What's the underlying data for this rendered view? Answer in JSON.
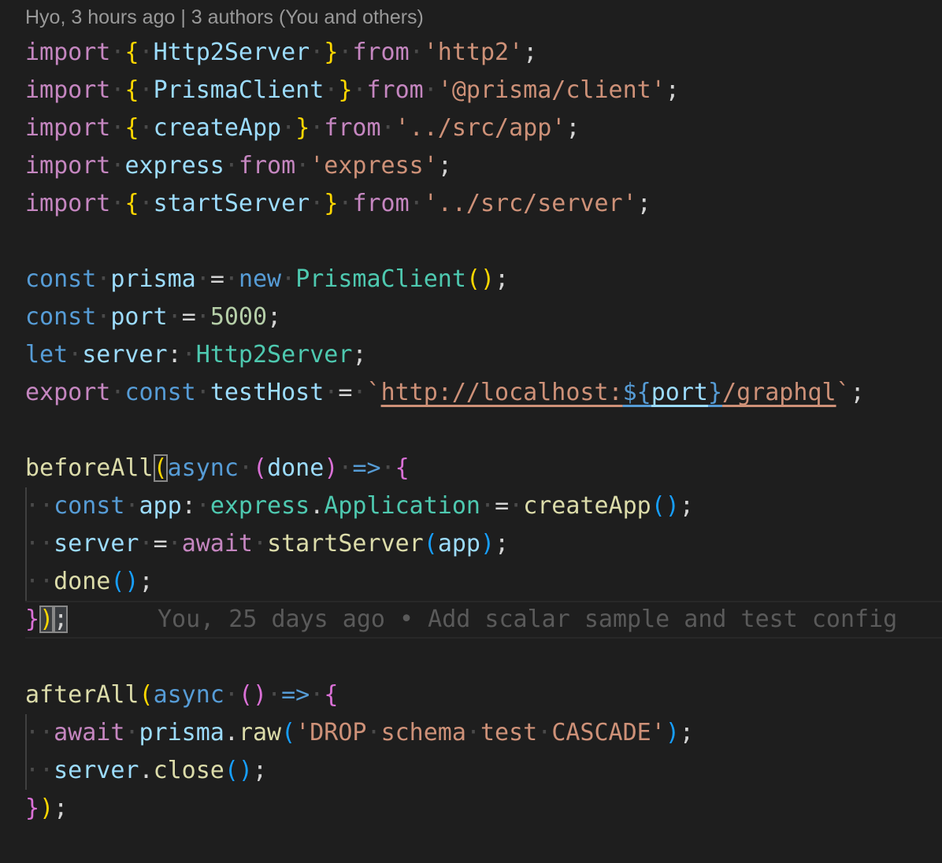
{
  "codelens": "Hyo, 3 hours ago | 3 authors (You and others)",
  "blame": "You, 25 days ago • Add scalar sample and test config",
  "lines": [
    [
      [
        "kw-ctrl",
        "import"
      ],
      [
        "ws",
        "·"
      ],
      [
        "b1",
        "{"
      ],
      [
        "ws",
        "·"
      ],
      [
        "var",
        "Http2Server"
      ],
      [
        "ws",
        "·"
      ],
      [
        "b1",
        "}"
      ],
      [
        "ws",
        "·"
      ],
      [
        "kw-ctrl",
        "from"
      ],
      [
        "ws",
        "·"
      ],
      [
        "str",
        "'http2'"
      ],
      [
        "op",
        ";"
      ]
    ],
    [
      [
        "kw-ctrl",
        "import"
      ],
      [
        "ws",
        "·"
      ],
      [
        "b1",
        "{"
      ],
      [
        "ws",
        "·"
      ],
      [
        "var",
        "PrismaClient"
      ],
      [
        "ws",
        "·"
      ],
      [
        "b1",
        "}"
      ],
      [
        "ws",
        "·"
      ],
      [
        "kw-ctrl",
        "from"
      ],
      [
        "ws",
        "·"
      ],
      [
        "str",
        "'@prisma/client'"
      ],
      [
        "op",
        ";"
      ]
    ],
    [
      [
        "kw-ctrl",
        "import"
      ],
      [
        "ws",
        "·"
      ],
      [
        "b1",
        "{"
      ],
      [
        "ws",
        "·"
      ],
      [
        "var",
        "createApp"
      ],
      [
        "ws",
        "·"
      ],
      [
        "b1",
        "}"
      ],
      [
        "ws",
        "·"
      ],
      [
        "kw-ctrl",
        "from"
      ],
      [
        "ws",
        "·"
      ],
      [
        "str",
        "'../src/app'"
      ],
      [
        "op",
        ";"
      ]
    ],
    [
      [
        "kw-ctrl",
        "import"
      ],
      [
        "ws",
        "·"
      ],
      [
        "var",
        "express"
      ],
      [
        "ws",
        "·"
      ],
      [
        "kw-ctrl",
        "from"
      ],
      [
        "ws",
        "·"
      ],
      [
        "str",
        "'express'"
      ],
      [
        "op",
        ";"
      ]
    ],
    [
      [
        "kw-ctrl",
        "import"
      ],
      [
        "ws",
        "·"
      ],
      [
        "b1",
        "{"
      ],
      [
        "ws",
        "·"
      ],
      [
        "var",
        "startServer"
      ],
      [
        "ws",
        "·"
      ],
      [
        "b1",
        "}"
      ],
      [
        "ws",
        "·"
      ],
      [
        "kw-ctrl",
        "from"
      ],
      [
        "ws",
        "·"
      ],
      [
        "str",
        "'../src/server'"
      ],
      [
        "op",
        ";"
      ]
    ],
    [],
    [
      [
        "kw",
        "const"
      ],
      [
        "ws",
        "·"
      ],
      [
        "var",
        "prisma"
      ],
      [
        "ws",
        "·"
      ],
      [
        "op",
        "="
      ],
      [
        "ws",
        "·"
      ],
      [
        "kw",
        "new"
      ],
      [
        "ws",
        "·"
      ],
      [
        "type",
        "PrismaClient"
      ],
      [
        "b1",
        "()"
      ],
      [
        "op",
        ";"
      ]
    ],
    [
      [
        "kw",
        "const"
      ],
      [
        "ws",
        "·"
      ],
      [
        "var",
        "port"
      ],
      [
        "ws",
        "·"
      ],
      [
        "op",
        "="
      ],
      [
        "ws",
        "·"
      ],
      [
        "num",
        "5000"
      ],
      [
        "op",
        ";"
      ]
    ],
    [
      [
        "kw",
        "let"
      ],
      [
        "ws",
        "·"
      ],
      [
        "var",
        "server"
      ],
      [
        "op",
        ":"
      ],
      [
        "ws",
        "·"
      ],
      [
        "type",
        "Http2Server"
      ],
      [
        "op",
        ";"
      ]
    ],
    [
      [
        "kw-ctrl",
        "export"
      ],
      [
        "ws",
        "·"
      ],
      [
        "kw",
        "const"
      ],
      [
        "ws",
        "·"
      ],
      [
        "var",
        "testHost"
      ],
      [
        "ws",
        "·"
      ],
      [
        "op",
        "="
      ],
      [
        "ws",
        "·"
      ],
      [
        "str",
        "`"
      ],
      [
        "str url",
        "http://localhost:"
      ],
      [
        "tmpl-k",
        "${"
      ],
      [
        "var urlv",
        "port"
      ],
      [
        "tmpl-k",
        "}"
      ],
      [
        "str url",
        "/graphql"
      ],
      [
        "str",
        "`"
      ],
      [
        "op",
        ";"
      ]
    ],
    [],
    [
      [
        "fn",
        "beforeAll"
      ],
      [
        "b1 match",
        "("
      ],
      [
        "kw",
        "async"
      ],
      [
        "ws",
        "·"
      ],
      [
        "b2",
        "("
      ],
      [
        "var",
        "done"
      ],
      [
        "b2",
        ")"
      ],
      [
        "ws",
        "·"
      ],
      [
        "kw",
        "=>"
      ],
      [
        "ws",
        "·"
      ],
      [
        "b2",
        "{"
      ]
    ],
    [
      [
        "ws",
        "··"
      ],
      [
        "kw",
        "const"
      ],
      [
        "ws",
        "·"
      ],
      [
        "var",
        "app"
      ],
      [
        "op",
        ":"
      ],
      [
        "ws",
        "·"
      ],
      [
        "type",
        "express"
      ],
      [
        "op",
        "."
      ],
      [
        "type",
        "Application"
      ],
      [
        "ws",
        "·"
      ],
      [
        "op",
        "="
      ],
      [
        "ws",
        "·"
      ],
      [
        "fn",
        "createApp"
      ],
      [
        "b3",
        "()"
      ],
      [
        "op",
        ";"
      ]
    ],
    [
      [
        "ws",
        "··"
      ],
      [
        "var",
        "server"
      ],
      [
        "ws",
        "·"
      ],
      [
        "op",
        "="
      ],
      [
        "ws",
        "·"
      ],
      [
        "kw-ctrl",
        "await"
      ],
      [
        "ws",
        "·"
      ],
      [
        "fn",
        "startServer"
      ],
      [
        "b3",
        "("
      ],
      [
        "var",
        "app"
      ],
      [
        "b3",
        ")"
      ],
      [
        "op",
        ";"
      ]
    ],
    [
      [
        "ws",
        "··"
      ],
      [
        "fn",
        "done"
      ],
      [
        "b3",
        "()"
      ],
      [
        "op",
        ";"
      ]
    ],
    [
      [
        "b2",
        "}"
      ],
      [
        "b1 match-sel",
        ")"
      ],
      [
        "op match-sel",
        ";"
      ]
    ],
    [],
    [
      [
        "fn",
        "afterAll"
      ],
      [
        "b1",
        "("
      ],
      [
        "kw",
        "async"
      ],
      [
        "ws",
        "·"
      ],
      [
        "b2",
        "()"
      ],
      [
        "ws",
        "·"
      ],
      [
        "kw",
        "=>"
      ],
      [
        "ws",
        "·"
      ],
      [
        "b2",
        "{"
      ]
    ],
    [
      [
        "ws",
        "··"
      ],
      [
        "kw-ctrl",
        "await"
      ],
      [
        "ws",
        "·"
      ],
      [
        "var",
        "prisma"
      ],
      [
        "op",
        "."
      ],
      [
        "fn",
        "raw"
      ],
      [
        "b3",
        "("
      ],
      [
        "str",
        "'DROP"
      ],
      [
        "ws",
        "·"
      ],
      [
        "str",
        "schema"
      ],
      [
        "ws",
        "·"
      ],
      [
        "str",
        "test"
      ],
      [
        "ws",
        "·"
      ],
      [
        "str",
        "CASCADE'"
      ],
      [
        "b3",
        ")"
      ],
      [
        "op",
        ";"
      ]
    ],
    [
      [
        "ws",
        "··"
      ],
      [
        "var",
        "server"
      ],
      [
        "op",
        "."
      ],
      [
        "fn",
        "close"
      ],
      [
        "b3",
        "()"
      ],
      [
        "op",
        ";"
      ]
    ],
    [
      [
        "b2",
        "}"
      ],
      [
        "b1",
        ")"
      ],
      [
        "op",
        ";"
      ]
    ]
  ]
}
